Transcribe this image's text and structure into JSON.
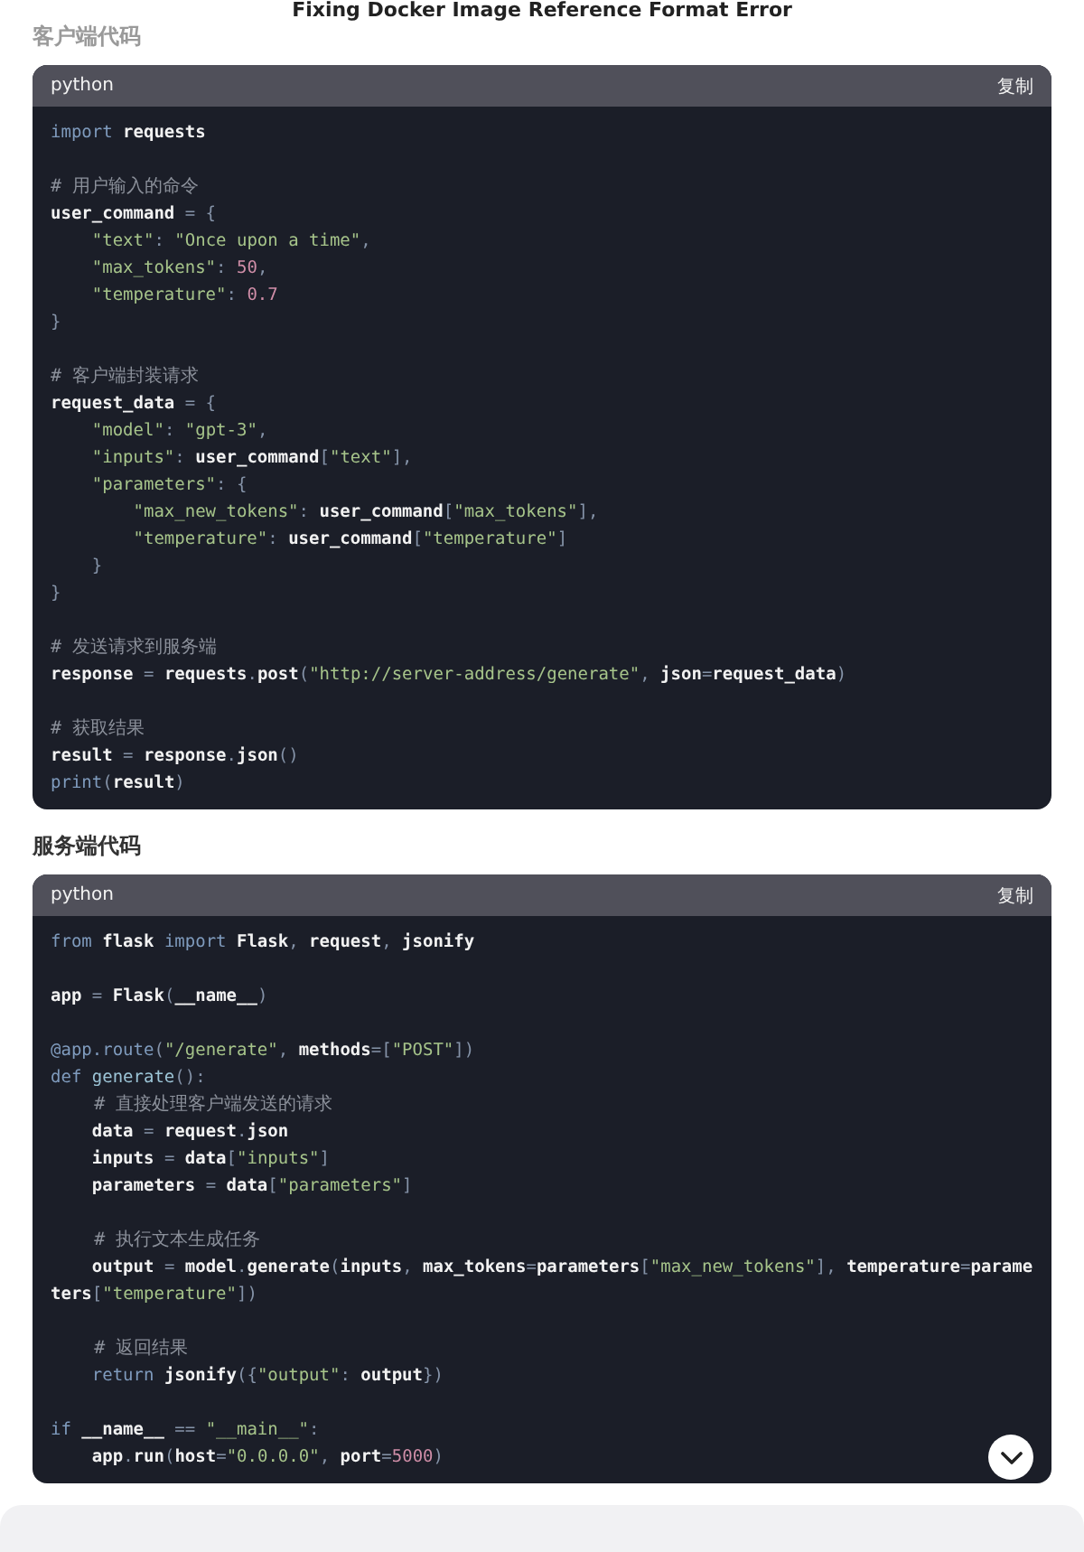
{
  "page_title": "Fixing Docker Image Reference Format Error",
  "sections": [
    {
      "heading": "客户端代码",
      "heading_muted": true,
      "code_block": {
        "language": "python",
        "copy_label": "复制",
        "lines": [
          {
            "tokens": [
              {
                "kind": "keyword",
                "text": "import "
              },
              {
                "kind": "name",
                "text": "requests"
              }
            ]
          },
          {
            "gap_before": true,
            "tokens": [
              {
                "kind": "comment",
                "text": "# 用户输入的命令"
              }
            ]
          },
          {
            "tokens": [
              {
                "kind": "name",
                "text": "user_command"
              },
              {
                "kind": "punct",
                "text": " = {"
              }
            ]
          },
          {
            "tokens": [
              {
                "kind": "string",
                "text": "    \"text\""
              },
              {
                "kind": "punct",
                "text": ": "
              },
              {
                "kind": "string",
                "text": "\"Once upon a time\""
              },
              {
                "kind": "punct",
                "text": ","
              }
            ]
          },
          {
            "tokens": [
              {
                "kind": "string",
                "text": "    \"max_tokens\""
              },
              {
                "kind": "punct",
                "text": ": "
              },
              {
                "kind": "number",
                "text": "50"
              },
              {
                "kind": "punct",
                "text": ","
              }
            ]
          },
          {
            "tokens": [
              {
                "kind": "string",
                "text": "    \"temperature\""
              },
              {
                "kind": "punct",
                "text": ": "
              },
              {
                "kind": "number",
                "text": "0.7"
              }
            ]
          },
          {
            "tokens": [
              {
                "kind": "punct",
                "text": "}"
              }
            ]
          },
          {
            "gap_before": true,
            "tokens": [
              {
                "kind": "comment",
                "text": "# 客户端封装请求"
              }
            ]
          },
          {
            "tokens": [
              {
                "kind": "name",
                "text": "request_data"
              },
              {
                "kind": "punct",
                "text": " = {"
              }
            ]
          },
          {
            "tokens": [
              {
                "kind": "string",
                "text": "    \"model\""
              },
              {
                "kind": "punct",
                "text": ": "
              },
              {
                "kind": "string",
                "text": "\"gpt-3\""
              },
              {
                "kind": "punct",
                "text": ","
              }
            ]
          },
          {
            "tokens": [
              {
                "kind": "string",
                "text": "    \"inputs\""
              },
              {
                "kind": "punct",
                "text": ": "
              },
              {
                "kind": "name",
                "text": "user_command"
              },
              {
                "kind": "punct",
                "text": "["
              },
              {
                "kind": "string",
                "text": "\"text\""
              },
              {
                "kind": "punct",
                "text": "],"
              }
            ]
          },
          {
            "tokens": [
              {
                "kind": "string",
                "text": "    \"parameters\""
              },
              {
                "kind": "punct",
                "text": ": {"
              }
            ]
          },
          {
            "tokens": [
              {
                "kind": "string",
                "text": "        \"max_new_tokens\""
              },
              {
                "kind": "punct",
                "text": ": "
              },
              {
                "kind": "name",
                "text": "user_command"
              },
              {
                "kind": "punct",
                "text": "["
              },
              {
                "kind": "string",
                "text": "\"max_tokens\""
              },
              {
                "kind": "punct",
                "text": "],"
              }
            ]
          },
          {
            "tokens": [
              {
                "kind": "string",
                "text": "        \"temperature\""
              },
              {
                "kind": "punct",
                "text": ": "
              },
              {
                "kind": "name",
                "text": "user_command"
              },
              {
                "kind": "punct",
                "text": "["
              },
              {
                "kind": "string",
                "text": "\"temperature\""
              },
              {
                "kind": "punct",
                "text": "]"
              }
            ]
          },
          {
            "tokens": [
              {
                "kind": "punct",
                "text": "    }"
              }
            ]
          },
          {
            "tokens": [
              {
                "kind": "punct",
                "text": "}"
              }
            ]
          },
          {
            "gap_before": true,
            "tokens": [
              {
                "kind": "comment",
                "text": "# 发送请求到服务端"
              }
            ]
          },
          {
            "tokens": [
              {
                "kind": "name",
                "text": "response"
              },
              {
                "kind": "punct",
                "text": " = "
              },
              {
                "kind": "name",
                "text": "requests"
              },
              {
                "kind": "punct",
                "text": "."
              },
              {
                "kind": "name",
                "text": "post"
              },
              {
                "kind": "punct",
                "text": "("
              },
              {
                "kind": "string",
                "text": "\"http://server-address/generate\""
              },
              {
                "kind": "punct",
                "text": ", "
              },
              {
                "kind": "name",
                "text": "json"
              },
              {
                "kind": "punct",
                "text": "="
              },
              {
                "kind": "name",
                "text": "request_data"
              },
              {
                "kind": "punct",
                "text": ")"
              }
            ]
          },
          {
            "gap_before": true,
            "tokens": [
              {
                "kind": "comment",
                "text": "# 获取结果"
              }
            ]
          },
          {
            "tokens": [
              {
                "kind": "name",
                "text": "result"
              },
              {
                "kind": "punct",
                "text": " = "
              },
              {
                "kind": "name",
                "text": "response"
              },
              {
                "kind": "punct",
                "text": "."
              },
              {
                "kind": "name",
                "text": "json"
              },
              {
                "kind": "punct",
                "text": "()"
              }
            ]
          },
          {
            "tokens": [
              {
                "kind": "keyword",
                "text": "print"
              },
              {
                "kind": "punct",
                "text": "("
              },
              {
                "kind": "name",
                "text": "result"
              },
              {
                "kind": "punct",
                "text": ")"
              }
            ]
          }
        ]
      }
    },
    {
      "heading": "服务端代码",
      "heading_muted": false,
      "code_block": {
        "language": "python",
        "copy_label": "复制",
        "scroll_button": true,
        "lines": [
          {
            "tokens": [
              {
                "kind": "keyword",
                "text": "from "
              },
              {
                "kind": "name",
                "text": "flask "
              },
              {
                "kind": "keyword",
                "text": "import "
              },
              {
                "kind": "name",
                "text": "Flask"
              },
              {
                "kind": "punct",
                "text": ", "
              },
              {
                "kind": "name",
                "text": "request"
              },
              {
                "kind": "punct",
                "text": ", "
              },
              {
                "kind": "name",
                "text": "jsonify"
              }
            ]
          },
          {
            "gap_before": true,
            "tokens": [
              {
                "kind": "name",
                "text": "app"
              },
              {
                "kind": "punct",
                "text": " = "
              },
              {
                "kind": "name",
                "text": "Flask"
              },
              {
                "kind": "punct",
                "text": "("
              },
              {
                "kind": "name",
                "text": "__name__"
              },
              {
                "kind": "punct",
                "text": ")"
              }
            ]
          },
          {
            "gap_before": true,
            "tokens": [
              {
                "kind": "keyword",
                "text": "@app.route"
              },
              {
                "kind": "punct",
                "text": "("
              },
              {
                "kind": "string",
                "text": "\"/generate\""
              },
              {
                "kind": "punct",
                "text": ", "
              },
              {
                "kind": "name",
                "text": "methods"
              },
              {
                "kind": "punct",
                "text": "=["
              },
              {
                "kind": "string",
                "text": "\"POST\""
              },
              {
                "kind": "punct",
                "text": "])"
              }
            ]
          },
          {
            "tokens": [
              {
                "kind": "keyword",
                "text": "def "
              },
              {
                "kind": "function",
                "text": "generate"
              },
              {
                "kind": "punct",
                "text": "():"
              }
            ]
          },
          {
            "tokens": [
              {
                "kind": "comment",
                "text": "    # 直接处理客户端发送的请求"
              }
            ]
          },
          {
            "tokens": [
              {
                "kind": "name",
                "text": "    data"
              },
              {
                "kind": "punct",
                "text": " = "
              },
              {
                "kind": "name",
                "text": "request"
              },
              {
                "kind": "punct",
                "text": "."
              },
              {
                "kind": "name",
                "text": "json"
              }
            ]
          },
          {
            "tokens": [
              {
                "kind": "name",
                "text": "    inputs"
              },
              {
                "kind": "punct",
                "text": " = "
              },
              {
                "kind": "name",
                "text": "data"
              },
              {
                "kind": "punct",
                "text": "["
              },
              {
                "kind": "string",
                "text": "\"inputs\""
              },
              {
                "kind": "punct",
                "text": "]"
              }
            ]
          },
          {
            "tokens": [
              {
                "kind": "name",
                "text": "    parameters"
              },
              {
                "kind": "punct",
                "text": " = "
              },
              {
                "kind": "name",
                "text": "data"
              },
              {
                "kind": "punct",
                "text": "["
              },
              {
                "kind": "string",
                "text": "\"parameters\""
              },
              {
                "kind": "punct",
                "text": "]"
              }
            ]
          },
          {
            "gap_before": true,
            "tokens": [
              {
                "kind": "comment",
                "text": "    # 执行文本生成任务"
              }
            ]
          },
          {
            "tokens": [
              {
                "kind": "name",
                "text": "    output"
              },
              {
                "kind": "punct",
                "text": " = "
              },
              {
                "kind": "name",
                "text": "model"
              },
              {
                "kind": "punct",
                "text": "."
              },
              {
                "kind": "name",
                "text": "generate"
              },
              {
                "kind": "punct",
                "text": "("
              },
              {
                "kind": "name",
                "text": "inputs"
              },
              {
                "kind": "punct",
                "text": ", "
              },
              {
                "kind": "name",
                "text": "max_tokens"
              },
              {
                "kind": "punct",
                "text": "="
              },
              {
                "kind": "name",
                "text": "parameters"
              },
              {
                "kind": "punct",
                "text": "["
              },
              {
                "kind": "string",
                "text": "\"max_new_tokens\""
              },
              {
                "kind": "punct",
                "text": "], "
              },
              {
                "kind": "name",
                "text": "temperature"
              },
              {
                "kind": "punct",
                "text": "="
              },
              {
                "kind": "name",
                "text": "parameters"
              },
              {
                "kind": "punct",
                "text": "["
              },
              {
                "kind": "string",
                "text": "\"temperature\""
              },
              {
                "kind": "punct",
                "text": "])"
              }
            ]
          },
          {
            "gap_before": true,
            "tokens": [
              {
                "kind": "comment",
                "text": "    # 返回结果"
              }
            ]
          },
          {
            "tokens": [
              {
                "kind": "keyword",
                "text": "    return "
              },
              {
                "kind": "name",
                "text": "jsonify"
              },
              {
                "kind": "punct",
                "text": "({"
              },
              {
                "kind": "string",
                "text": "\"output\""
              },
              {
                "kind": "punct",
                "text": ": "
              },
              {
                "kind": "name",
                "text": "output"
              },
              {
                "kind": "punct",
                "text": "})"
              }
            ]
          },
          {
            "gap_before": true,
            "tokens": [
              {
                "kind": "keyword",
                "text": "if "
              },
              {
                "kind": "name",
                "text": "__name__"
              },
              {
                "kind": "punct",
                "text": " == "
              },
              {
                "kind": "string",
                "text": "\"__main__\""
              },
              {
                "kind": "punct",
                "text": ":"
              }
            ]
          },
          {
            "tokens": [
              {
                "kind": "name",
                "text": "    app"
              },
              {
                "kind": "punct",
                "text": "."
              },
              {
                "kind": "name",
                "text": "run"
              },
              {
                "kind": "punct",
                "text": "("
              },
              {
                "kind": "name",
                "text": "host"
              },
              {
                "kind": "punct",
                "text": "="
              },
              {
                "kind": "string",
                "text": "\"0.0.0.0\""
              },
              {
                "kind": "punct",
                "text": ", "
              },
              {
                "kind": "name",
                "text": "port"
              },
              {
                "kind": "punct",
                "text": "="
              },
              {
                "kind": "number",
                "text": "5000"
              },
              {
                "kind": "punct",
                "text": ")"
              }
            ]
          }
        ]
      }
    }
  ]
}
